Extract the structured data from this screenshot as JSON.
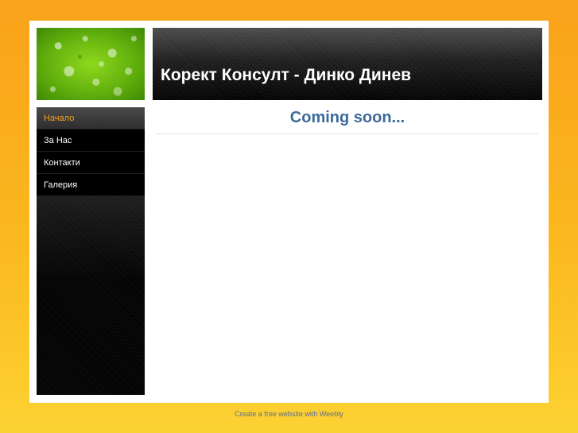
{
  "header": {
    "site_title": "Корект Консулт - Динко Динев",
    "image_name": "green-leaf-water-drops"
  },
  "sidebar": {
    "items": [
      {
        "label": "Начало",
        "active": true
      },
      {
        "label": "За Нас",
        "active": false
      },
      {
        "label": "Контакти",
        "active": false
      },
      {
        "label": "Галерия",
        "active": false
      }
    ]
  },
  "main": {
    "heading": "Coming soon..."
  },
  "footer": {
    "link_text": "Create a free website with Weebly"
  },
  "colors": {
    "background_top": "#f9a21a",
    "background_bottom": "#fcd233",
    "active_nav_text": "#f7a21b",
    "heading": "#3d6a9b"
  }
}
